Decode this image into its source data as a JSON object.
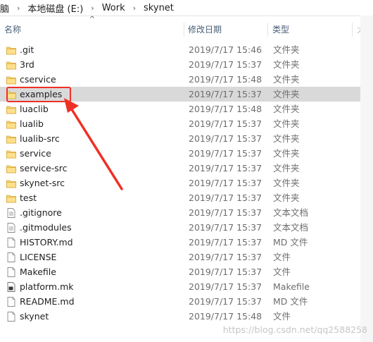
{
  "breadcrumb": {
    "items": [
      "脑",
      "本地磁盘 (E:)",
      "Work",
      "skynet"
    ],
    "separator": "›"
  },
  "sort_indicator": "^",
  "columns": {
    "name": "名称",
    "date": "修改日期",
    "type": "类型",
    "extra": "大"
  },
  "files": [
    {
      "name": ".git",
      "date": "2019/7/17 15:46",
      "type": "文件夹",
      "icon": "folder-icon"
    },
    {
      "name": "3rd",
      "date": "2019/7/17 15:37",
      "type": "文件夹",
      "icon": "folder-icon"
    },
    {
      "name": "cservice",
      "date": "2019/7/17 15:48",
      "type": "文件夹",
      "icon": "folder-icon"
    },
    {
      "name": "examples",
      "date": "2019/7/17 15:37",
      "type": "文件夹",
      "icon": "folder-icon"
    },
    {
      "name": "luaclib",
      "date": "2019/7/17 15:48",
      "type": "文件夹",
      "icon": "folder-icon"
    },
    {
      "name": "lualib",
      "date": "2019/7/17 15:37",
      "type": "文件夹",
      "icon": "folder-icon"
    },
    {
      "name": "lualib-src",
      "date": "2019/7/17 15:37",
      "type": "文件夹",
      "icon": "folder-icon"
    },
    {
      "name": "service",
      "date": "2019/7/17 15:37",
      "type": "文件夹",
      "icon": "folder-icon"
    },
    {
      "name": "service-src",
      "date": "2019/7/17 15:37",
      "type": "文件夹",
      "icon": "folder-icon"
    },
    {
      "name": "skynet-src",
      "date": "2019/7/17 15:37",
      "type": "文件夹",
      "icon": "folder-icon"
    },
    {
      "name": "test",
      "date": "2019/7/17 15:37",
      "type": "文件夹",
      "icon": "folder-icon"
    },
    {
      "name": ".gitignore",
      "date": "2019/7/17 15:37",
      "type": "文本文档",
      "icon": "text-file-icon"
    },
    {
      "name": ".gitmodules",
      "date": "2019/7/17 15:37",
      "type": "文本文档",
      "icon": "text-file-icon"
    },
    {
      "name": "HISTORY.md",
      "date": "2019/7/17 15:37",
      "type": "MD 文件",
      "icon": "file-icon"
    },
    {
      "name": "LICENSE",
      "date": "2019/7/17 15:37",
      "type": "文件",
      "icon": "file-icon"
    },
    {
      "name": "Makefile",
      "date": "2019/7/17 15:37",
      "type": "文件",
      "icon": "file-icon"
    },
    {
      "name": "platform.mk",
      "date": "2019/7/17 15:37",
      "type": "Makefile",
      "icon": "makefile-icon"
    },
    {
      "name": "README.md",
      "date": "2019/7/17 15:37",
      "type": "MD 文件",
      "icon": "file-icon"
    },
    {
      "name": "skynet",
      "date": "2019/7/17 15:48",
      "type": "文件",
      "icon": "file-icon"
    }
  ],
  "selected_index": 3,
  "watermark": "https://blog.csdn.net/qq2588258",
  "colors": {
    "selection": "#d9d9d9",
    "annotation": "#ef3026",
    "folder": "#f8d775"
  }
}
